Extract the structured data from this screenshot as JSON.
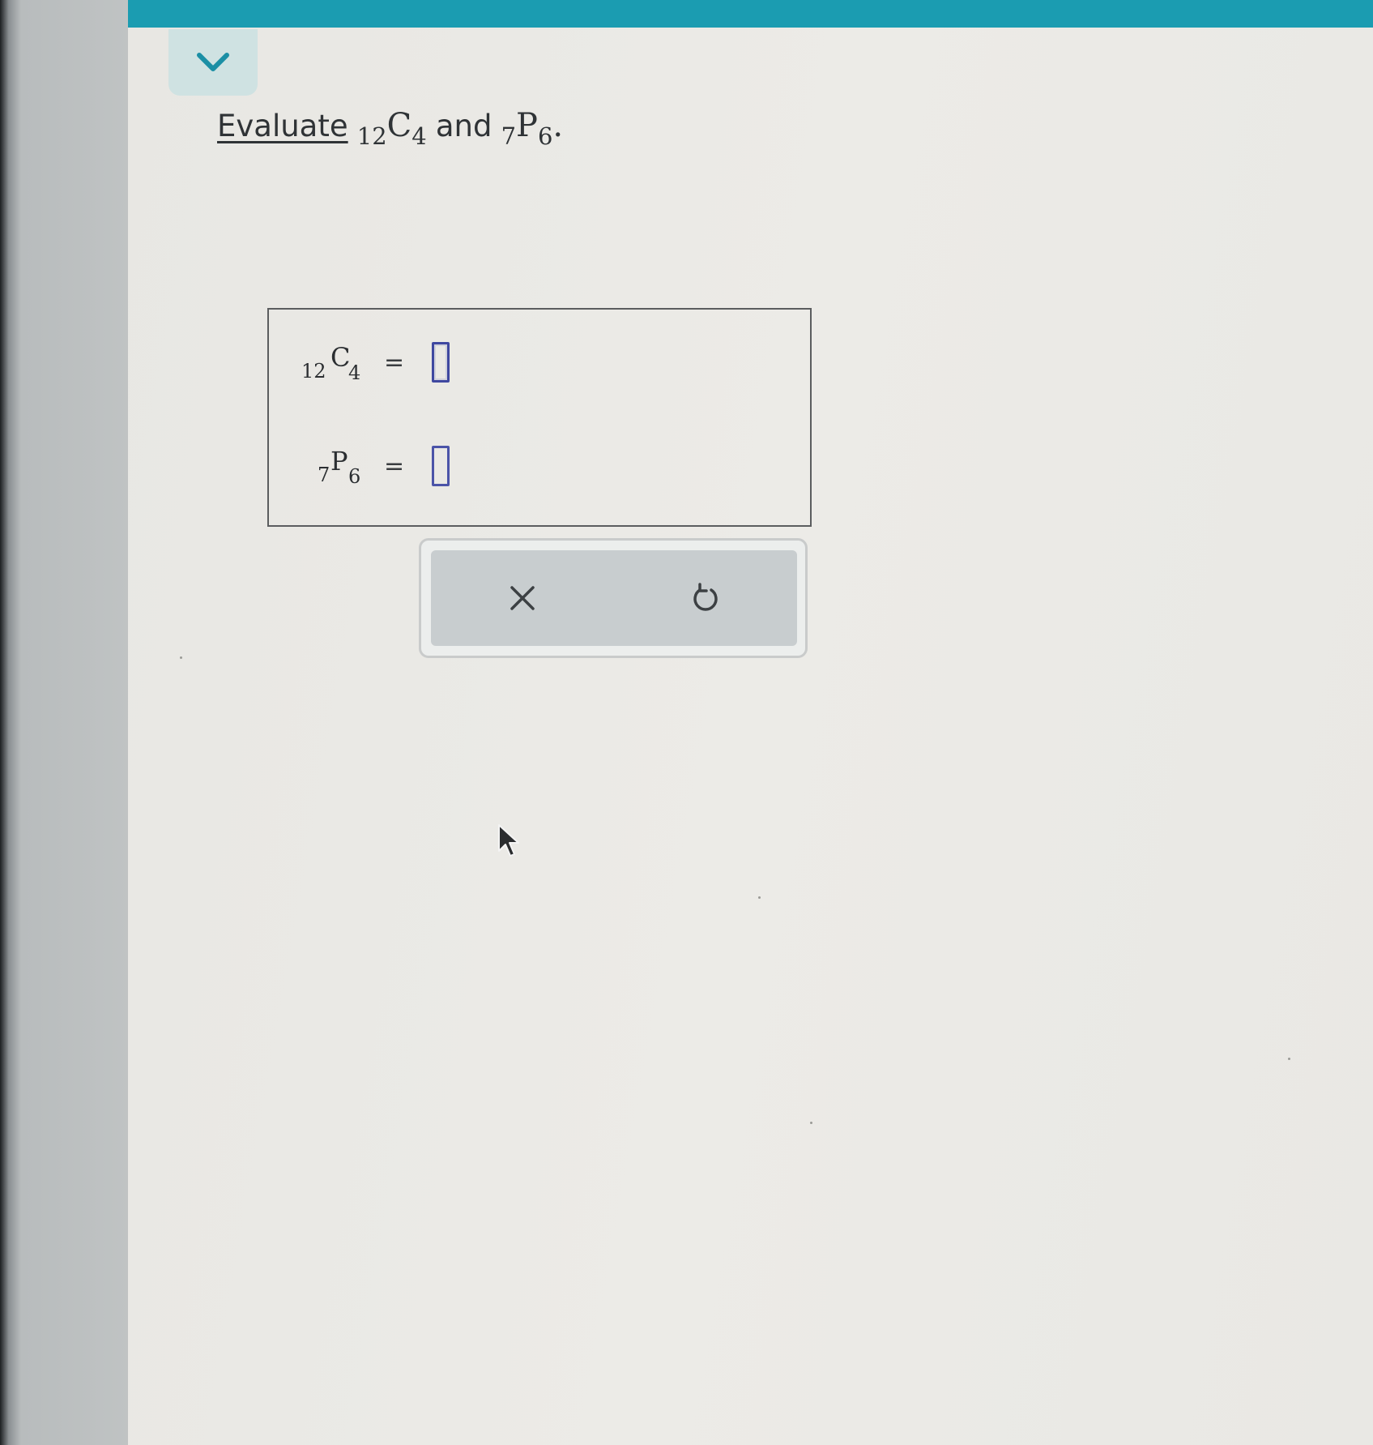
{
  "header": {
    "accent_color": "#1b9cb1",
    "collapse_icon": "chevron-down-icon"
  },
  "question": {
    "prefix": "Evaluate",
    "term1": {
      "base": "C",
      "pre": "12",
      "post": "4"
    },
    "conjunction": "and",
    "term2": {
      "base": "P",
      "pre": "7",
      "post": "6"
    },
    "suffix": "."
  },
  "answers": [
    {
      "pre": "12",
      "base": "C",
      "post": "4",
      "equals": "=",
      "value": ""
    },
    {
      "pre": "7",
      "base": "P",
      "post": "6",
      "equals": "=",
      "value": ""
    }
  ],
  "actions": {
    "clear_icon": "close-icon",
    "undo_icon": "undo-icon"
  }
}
